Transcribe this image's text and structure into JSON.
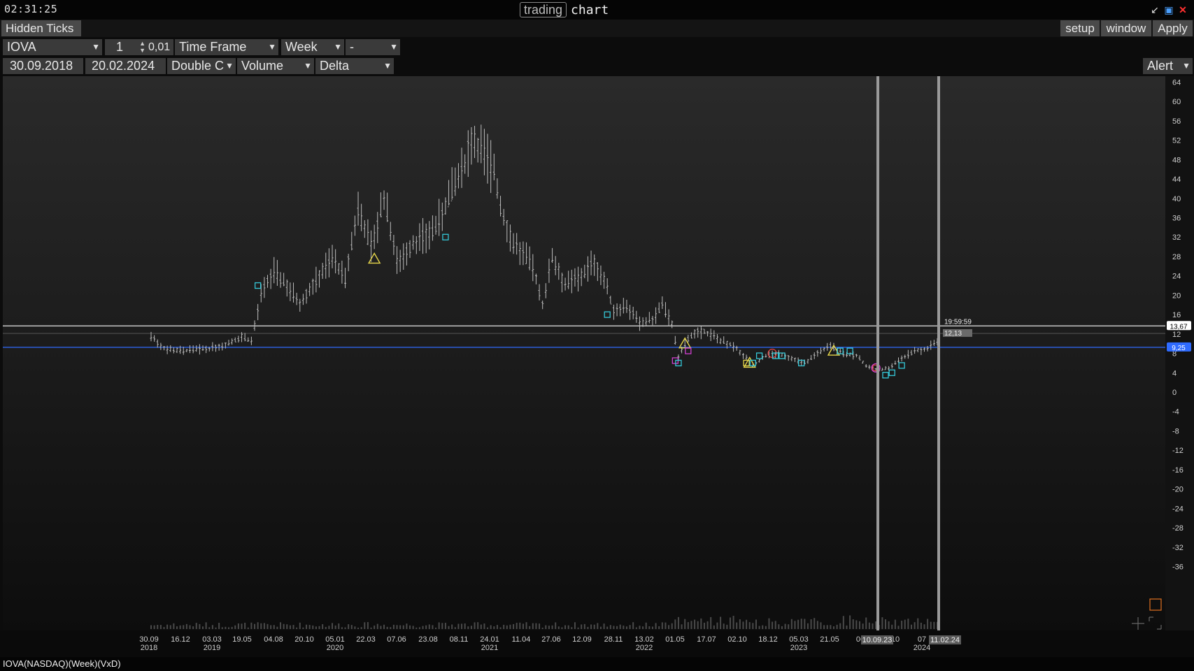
{
  "titlebar": {
    "clock": "02:31:25",
    "title_boxed": "trading",
    "title_plain": "chart",
    "icons": [
      "minimize-icon",
      "maximize-icon",
      "close-icon"
    ]
  },
  "toolbar": {
    "hidden_ticks": "Hidden Ticks",
    "setup": "setup",
    "window": "window",
    "apply": "Apply",
    "symbol": "IOVA",
    "multiplier": "1",
    "step": "0,01",
    "timeframe_label": "Time Frame",
    "timeframe_value": "Week",
    "extra_value": "-",
    "date_from": "30.09.2018",
    "date_to": "20.02.2024",
    "chart_type": "Double C",
    "indicator1": "Volume",
    "indicator2": "Delta",
    "alert": "Alert"
  },
  "status": {
    "text": "IOVA(NASDAQ)(Week)(VxD)"
  },
  "colors": {
    "accent_blue": "#2f6bff",
    "cyan_marker": "#35c8d8",
    "yellow_marker": "#e8d84a",
    "magenta_marker": "#d040d0",
    "red_marker": "#e04040"
  },
  "chart_data": {
    "type": "candlestick",
    "ylim": [
      -38,
      66
    ],
    "yticks": [
      64,
      60,
      56,
      52,
      48,
      44,
      40,
      36,
      32,
      28,
      24,
      20,
      16,
      12,
      8,
      4,
      0,
      -4,
      -8,
      -12,
      -16,
      -20,
      -24,
      -28,
      -32,
      -36
    ],
    "x_ticks": [
      {
        "d": "30.09",
        "y": "2018"
      },
      {
        "d": "16.12",
        "y": ""
      },
      {
        "d": "03.03",
        "y": "2019"
      },
      {
        "d": "19.05",
        "y": ""
      },
      {
        "d": "04.08",
        "y": ""
      },
      {
        "d": "20.10",
        "y": ""
      },
      {
        "d": "05.01",
        "y": "2020"
      },
      {
        "d": "22.03",
        "y": ""
      },
      {
        "d": "07.06",
        "y": ""
      },
      {
        "d": "23.08",
        "y": ""
      },
      {
        "d": "08.11",
        "y": ""
      },
      {
        "d": "24.01",
        "y": "2021"
      },
      {
        "d": "11.04",
        "y": ""
      },
      {
        "d": "27.06",
        "y": ""
      },
      {
        "d": "12.09",
        "y": ""
      },
      {
        "d": "28.11",
        "y": ""
      },
      {
        "d": "13.02",
        "y": "2022"
      },
      {
        "d": "01.05",
        "y": ""
      },
      {
        "d": "17.07",
        "y": ""
      },
      {
        "d": "02.10",
        "y": ""
      },
      {
        "d": "18.12",
        "y": ""
      },
      {
        "d": "05.03",
        "y": "2023"
      },
      {
        "d": "21.05",
        "y": ""
      },
      {
        "d": "06",
        "y": ""
      },
      {
        "d": "10",
        "y": ""
      },
      {
        "d": "07",
        "y": "2024"
      }
    ],
    "cursor_labels": [
      "10.09.23",
      "11.02.24"
    ],
    "price_tags": {
      "white_line": "13,67",
      "blue_line": "9,25",
      "time_label": "19:59:59",
      "grey_label": "12,13"
    },
    "hlines": {
      "white": 13.67,
      "blue": 9.25,
      "grey": 12.13
    },
    "anchors": [
      [
        0,
        11.5
      ],
      [
        4,
        9.0
      ],
      [
        10,
        8.5
      ],
      [
        18,
        9.0
      ],
      [
        24,
        10.0
      ],
      [
        28,
        11.5
      ],
      [
        31,
        10.5
      ],
      [
        34,
        20.0
      ],
      [
        38,
        25.0
      ],
      [
        42,
        22.0
      ],
      [
        46,
        18.5
      ],
      [
        52,
        24.0
      ],
      [
        56,
        28.0
      ],
      [
        60,
        23.0
      ],
      [
        64,
        38.0
      ],
      [
        68,
        30.0
      ],
      [
        72,
        40.0
      ],
      [
        76,
        27.0
      ],
      [
        80,
        30.0
      ],
      [
        84,
        32.0
      ],
      [
        88,
        34.0
      ],
      [
        92,
        40.0
      ],
      [
        96,
        45.0
      ],
      [
        99,
        52.0
      ],
      [
        102,
        50.0
      ],
      [
        106,
        46.0
      ],
      [
        108,
        38.0
      ],
      [
        111,
        32.0
      ],
      [
        114,
        29.0
      ],
      [
        118,
        26.0
      ],
      [
        121,
        18.0
      ],
      [
        124,
        28.0
      ],
      [
        128,
        22.0
      ],
      [
        133,
        24.0
      ],
      [
        137,
        27.0
      ],
      [
        140,
        23.0
      ],
      [
        143,
        17.0
      ],
      [
        147,
        18.0
      ],
      [
        151,
        14.0
      ],
      [
        155,
        15.0
      ],
      [
        158,
        18.0
      ],
      [
        161,
        14.0
      ],
      [
        163,
        7.0
      ],
      [
        165,
        10.0
      ],
      [
        168,
        12.5
      ],
      [
        171,
        12.5
      ],
      [
        175,
        11.0
      ],
      [
        180,
        9.5
      ],
      [
        184,
        7.0
      ],
      [
        186,
        5.5
      ],
      [
        190,
        7.5
      ],
      [
        194,
        8.0
      ],
      [
        198,
        7.0
      ],
      [
        202,
        6.0
      ],
      [
        206,
        8.0
      ],
      [
        210,
        9.5
      ],
      [
        214,
        8.0
      ],
      [
        218,
        7.5
      ],
      [
        221,
        5.5
      ],
      [
        225,
        4.5
      ],
      [
        228,
        5.0
      ],
      [
        232,
        7.0
      ],
      [
        236,
        8.5
      ],
      [
        240,
        9.0
      ],
      [
        243,
        10.5
      ]
    ],
    "markers": [
      {
        "t": "triangle",
        "i": 69,
        "p": 27.5,
        "c": "#e8d84a"
      },
      {
        "t": "square",
        "i": 33,
        "p": 22.0,
        "c": "#35c8d8"
      },
      {
        "t": "square",
        "i": 91,
        "p": 32.0,
        "c": "#35c8d8"
      },
      {
        "t": "square",
        "i": 141,
        "p": 16.0,
        "c": "#35c8d8"
      },
      {
        "t": "square",
        "i": 162,
        "p": 6.5,
        "c": "#d040d0"
      },
      {
        "t": "square",
        "i": 163,
        "p": 6.0,
        "c": "#35c8d8"
      },
      {
        "t": "triangle",
        "i": 165,
        "p": 10.0,
        "c": "#e8d84a"
      },
      {
        "t": "square",
        "i": 166,
        "p": 8.5,
        "c": "#d040d0"
      },
      {
        "t": "square",
        "i": 184,
        "p": 6.0,
        "c": "#e8d84a"
      },
      {
        "t": "triangle",
        "i": 185,
        "p": 6.0,
        "c": "#e8d84a"
      },
      {
        "t": "square",
        "i": 186,
        "p": 6.0,
        "c": "#35c8d8"
      },
      {
        "t": "square",
        "i": 188,
        "p": 7.5,
        "c": "#35c8d8"
      },
      {
        "t": "circle",
        "i": 192,
        "p": 8.0,
        "c": "#e04040"
      },
      {
        "t": "square",
        "i": 193,
        "p": 7.5,
        "c": "#35c8d8"
      },
      {
        "t": "square",
        "i": 195,
        "p": 7.5,
        "c": "#35c8d8"
      },
      {
        "t": "square",
        "i": 201,
        "p": 6.0,
        "c": "#35c8d8"
      },
      {
        "t": "triangle",
        "i": 211,
        "p": 8.5,
        "c": "#e8d84a"
      },
      {
        "t": "square",
        "i": 213,
        "p": 8.5,
        "c": "#35c8d8"
      },
      {
        "t": "square",
        "i": 216,
        "p": 8.5,
        "c": "#35c8d8"
      },
      {
        "t": "square",
        "i": 224,
        "p": 5.0,
        "c": "#e04040"
      },
      {
        "t": "circle",
        "i": 224,
        "p": 5.0,
        "c": "#d040d0"
      },
      {
        "t": "square",
        "i": 227,
        "p": 3.5,
        "c": "#35c8d8"
      },
      {
        "t": "square",
        "i": 229,
        "p": 4.0,
        "c": "#35c8d8"
      },
      {
        "t": "square",
        "i": 232,
        "p": 5.5,
        "c": "#35c8d8"
      }
    ]
  }
}
